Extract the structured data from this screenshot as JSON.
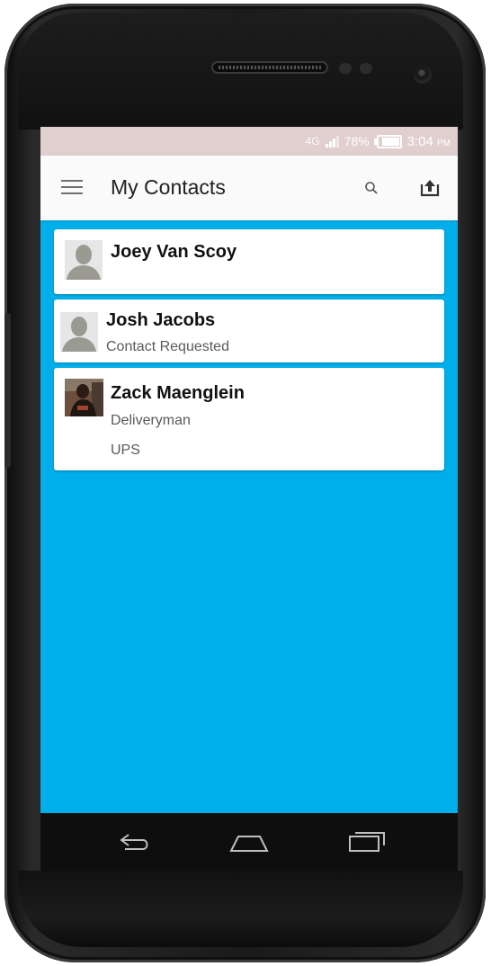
{
  "status_bar": {
    "network": "4G",
    "battery_percent": "78%",
    "time": "3:04",
    "time_suffix": "PM"
  },
  "app_bar": {
    "title": "My Contacts",
    "menu_icon": "hamburger-menu-icon",
    "search_icon": "search-icon",
    "upload_icon": "upload-icon"
  },
  "contacts": [
    {
      "name": "Joey Van Scoy",
      "lines": [],
      "avatar": "default-person-icon"
    },
    {
      "name": "Josh Jacobs",
      "lines": [
        "Contact Requested"
      ],
      "avatar": "default-person-icon"
    },
    {
      "name": "Zack Maenglein",
      "lines": [
        "Deliveryman",
        "UPS"
      ],
      "avatar": "person-photo"
    }
  ],
  "nav_bar": {
    "back_icon": "back-icon",
    "home_icon": "home-icon",
    "recents_icon": "recent-apps-icon"
  },
  "colors": {
    "list_background": "#00aee9",
    "status_bar": "#e1cfcf",
    "app_bar": "#fafafa"
  }
}
